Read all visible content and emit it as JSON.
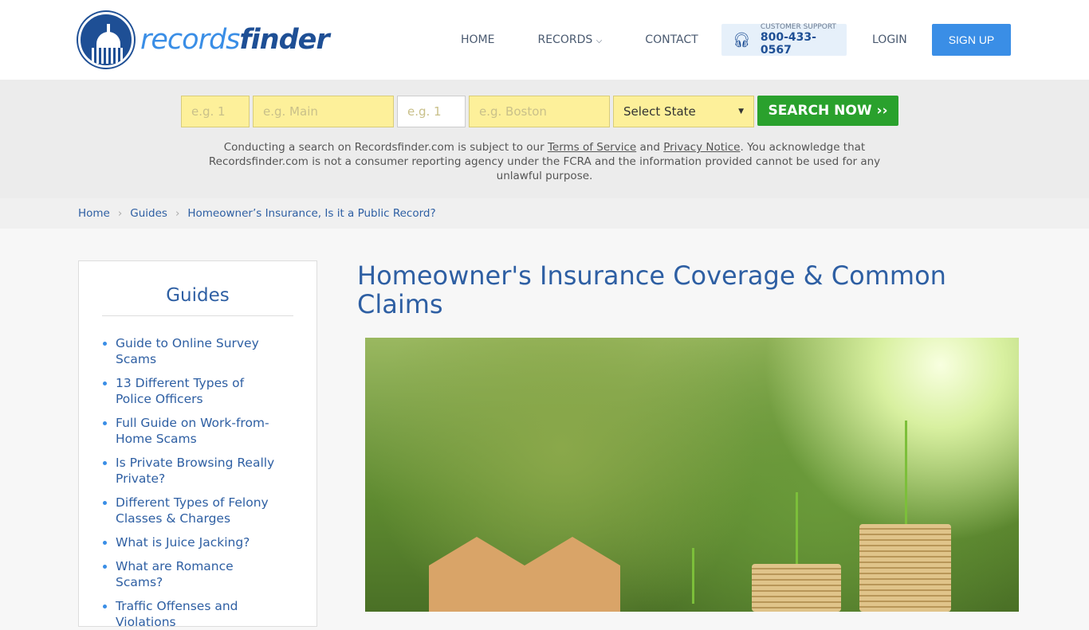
{
  "header": {
    "logo_a": "records",
    "logo_b": "finder",
    "nav": [
      "HOME",
      "RECORDS",
      "CONTACT"
    ],
    "support_label": "CUSTOMER SUPPORT",
    "support_phone": "800-433-0567",
    "login": "LOGIN",
    "signup": "SIGN UP"
  },
  "search": {
    "placeholders": [
      "e.g. 1",
      "e.g. Main",
      "e.g. 1",
      "e.g. Boston"
    ],
    "state": "Select State",
    "button": "SEARCH NOW ››",
    "disc_1": "Conducting a search on Recordsfinder.com is subject to our ",
    "terms": "Terms of Service",
    "disc_2": " and ",
    "privacy": "Privacy Notice",
    "disc_3": ". You acknowledge that Recordsfinder.com is not a consumer reporting agency under the FCRA and the information provided cannot be used for any unlawful purpose."
  },
  "breadcrumb": [
    "Home",
    "Guides",
    "Homeowner’s Insurance, Is it a Public Record?"
  ],
  "sidebar": {
    "title": "Guides",
    "items": [
      "Guide to Online Survey Scams",
      "13 Different Types of Police Officers",
      "Full Guide on Work-from-Home Scams",
      "Is Private Browsing Really Private?",
      "Different Types of Felony Classes & Charges",
      "What is Juice Jacking?",
      "What are Romance Scams?",
      "Traffic Offenses and Violations"
    ]
  },
  "article": {
    "title": "Homeowner's Insurance Coverage & Common Claims"
  }
}
